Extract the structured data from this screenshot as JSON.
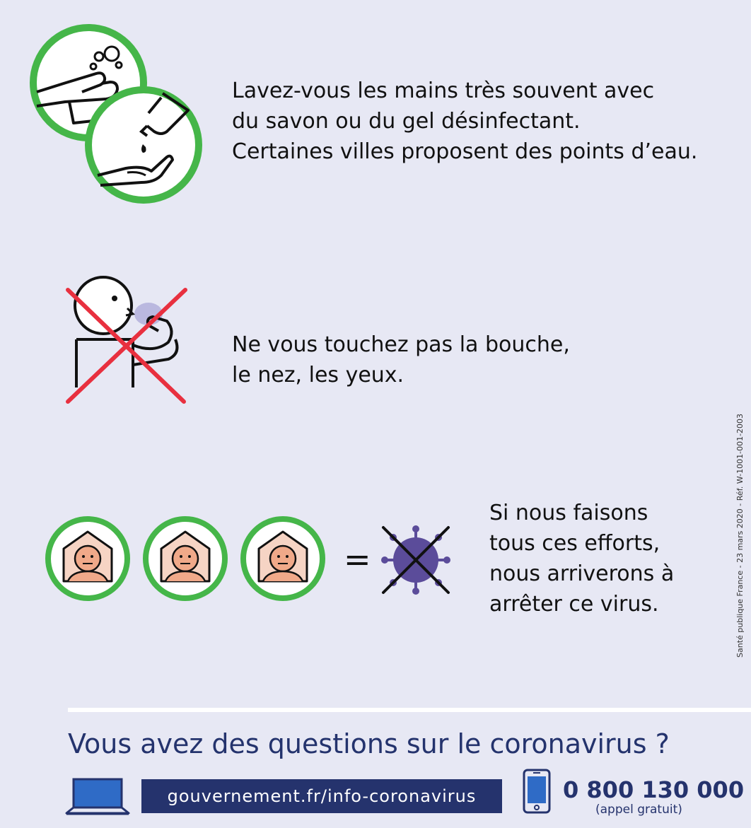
{
  "sections": {
    "handwashing": {
      "lines": [
        "Lavez-vous les mains très souvent avec",
        "du savon ou du gel désinfectant.",
        "Certaines villes proposent des points d’eau."
      ]
    },
    "no_touch": {
      "lines": [
        "Ne vous touchez pas la bouche,",
        "le nez, les yeux."
      ]
    },
    "together": {
      "equals": "=",
      "lines": [
        "Si nous faisons",
        "tous ces efforts,",
        "nous arriverons à",
        "arrêter ce virus."
      ]
    }
  },
  "footer": {
    "question": "Vous avez des questions sur le coronavirus ?",
    "url": "gouvernement.fr/info-coronavirus",
    "phone_number": "0 800 130 000",
    "phone_note": "(appel gratuit)"
  },
  "side_reference": "Santé publique France - 23 mars 2020 - Réf. W-1001-001-2003",
  "icons": [
    "handwashing-icon",
    "sanitizer-gel-icon",
    "no-face-touch-icon",
    "stay-home-person-icon",
    "crossed-virus-icon",
    "laptop-icon",
    "smartphone-icon"
  ],
  "colors": {
    "background": "#e7e8f4",
    "green_ring": "#45b649",
    "red_cross": "#e8303f",
    "navy": "#25336d",
    "virus": "#5b4c9a",
    "face": "#f0a989"
  }
}
